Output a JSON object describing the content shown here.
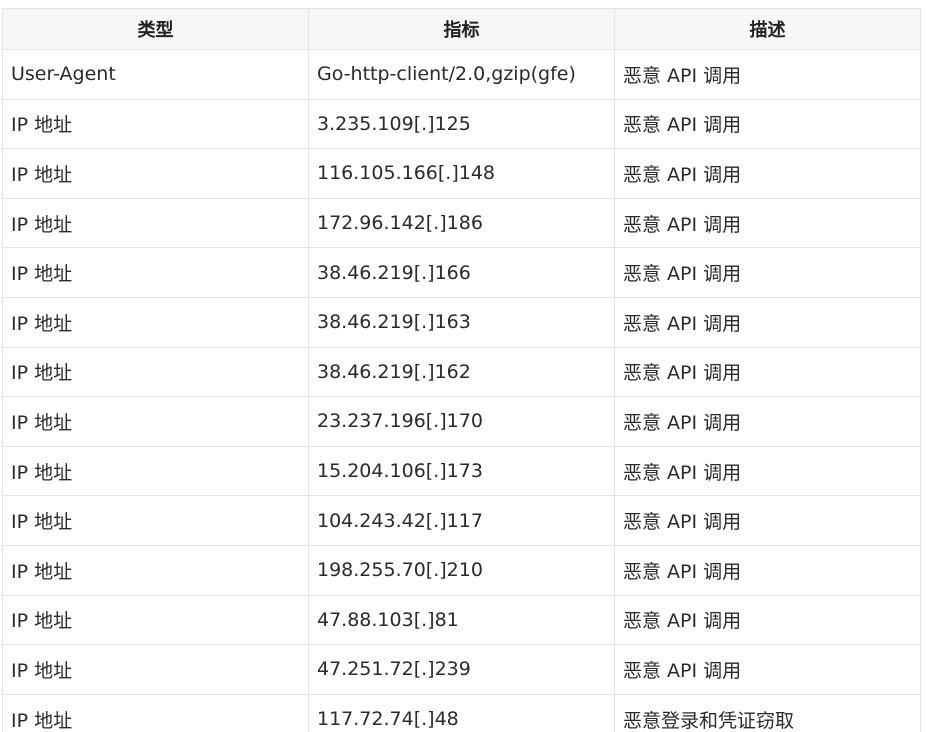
{
  "table": {
    "headers": [
      "类型",
      "指标",
      "描述"
    ],
    "rows": [
      [
        "User-Agent",
        "Go-http-client/2.0,gzip(gfe)",
        "恶意 API 调用"
      ],
      [
        "IP 地址",
        "3.235.109[.]125",
        "恶意 API 调用"
      ],
      [
        "IP 地址",
        "116.105.166[.]148",
        "恶意 API 调用"
      ],
      [
        "IP 地址",
        "172.96.142[.]186",
        "恶意 API 调用"
      ],
      [
        "IP 地址",
        "38.46.219[.]166",
        "恶意 API 调用"
      ],
      [
        "IP 地址",
        "38.46.219[.]163",
        "恶意 API 调用"
      ],
      [
        "IP 地址",
        "38.46.219[.]162",
        "恶意 API 调用"
      ],
      [
        "IP 地址",
        "23.237.196[.]170",
        "恶意 API 调用"
      ],
      [
        "IP 地址",
        "15.204.106[.]173",
        "恶意 API 调用"
      ],
      [
        "IP 地址",
        "104.243.42[.]117",
        "恶意 API 调用"
      ],
      [
        "IP 地址",
        "198.255.70[.]210",
        "恶意 API 调用"
      ],
      [
        "IP 地址",
        "47.88.103[.]81",
        "恶意 API 调用"
      ],
      [
        "IP 地址",
        "47.251.72[.]239",
        "恶意 API 调用"
      ],
      [
        "IP 地址",
        "117.72.74[.]48",
        "恶意登录和凭证窃取"
      ]
    ]
  }
}
